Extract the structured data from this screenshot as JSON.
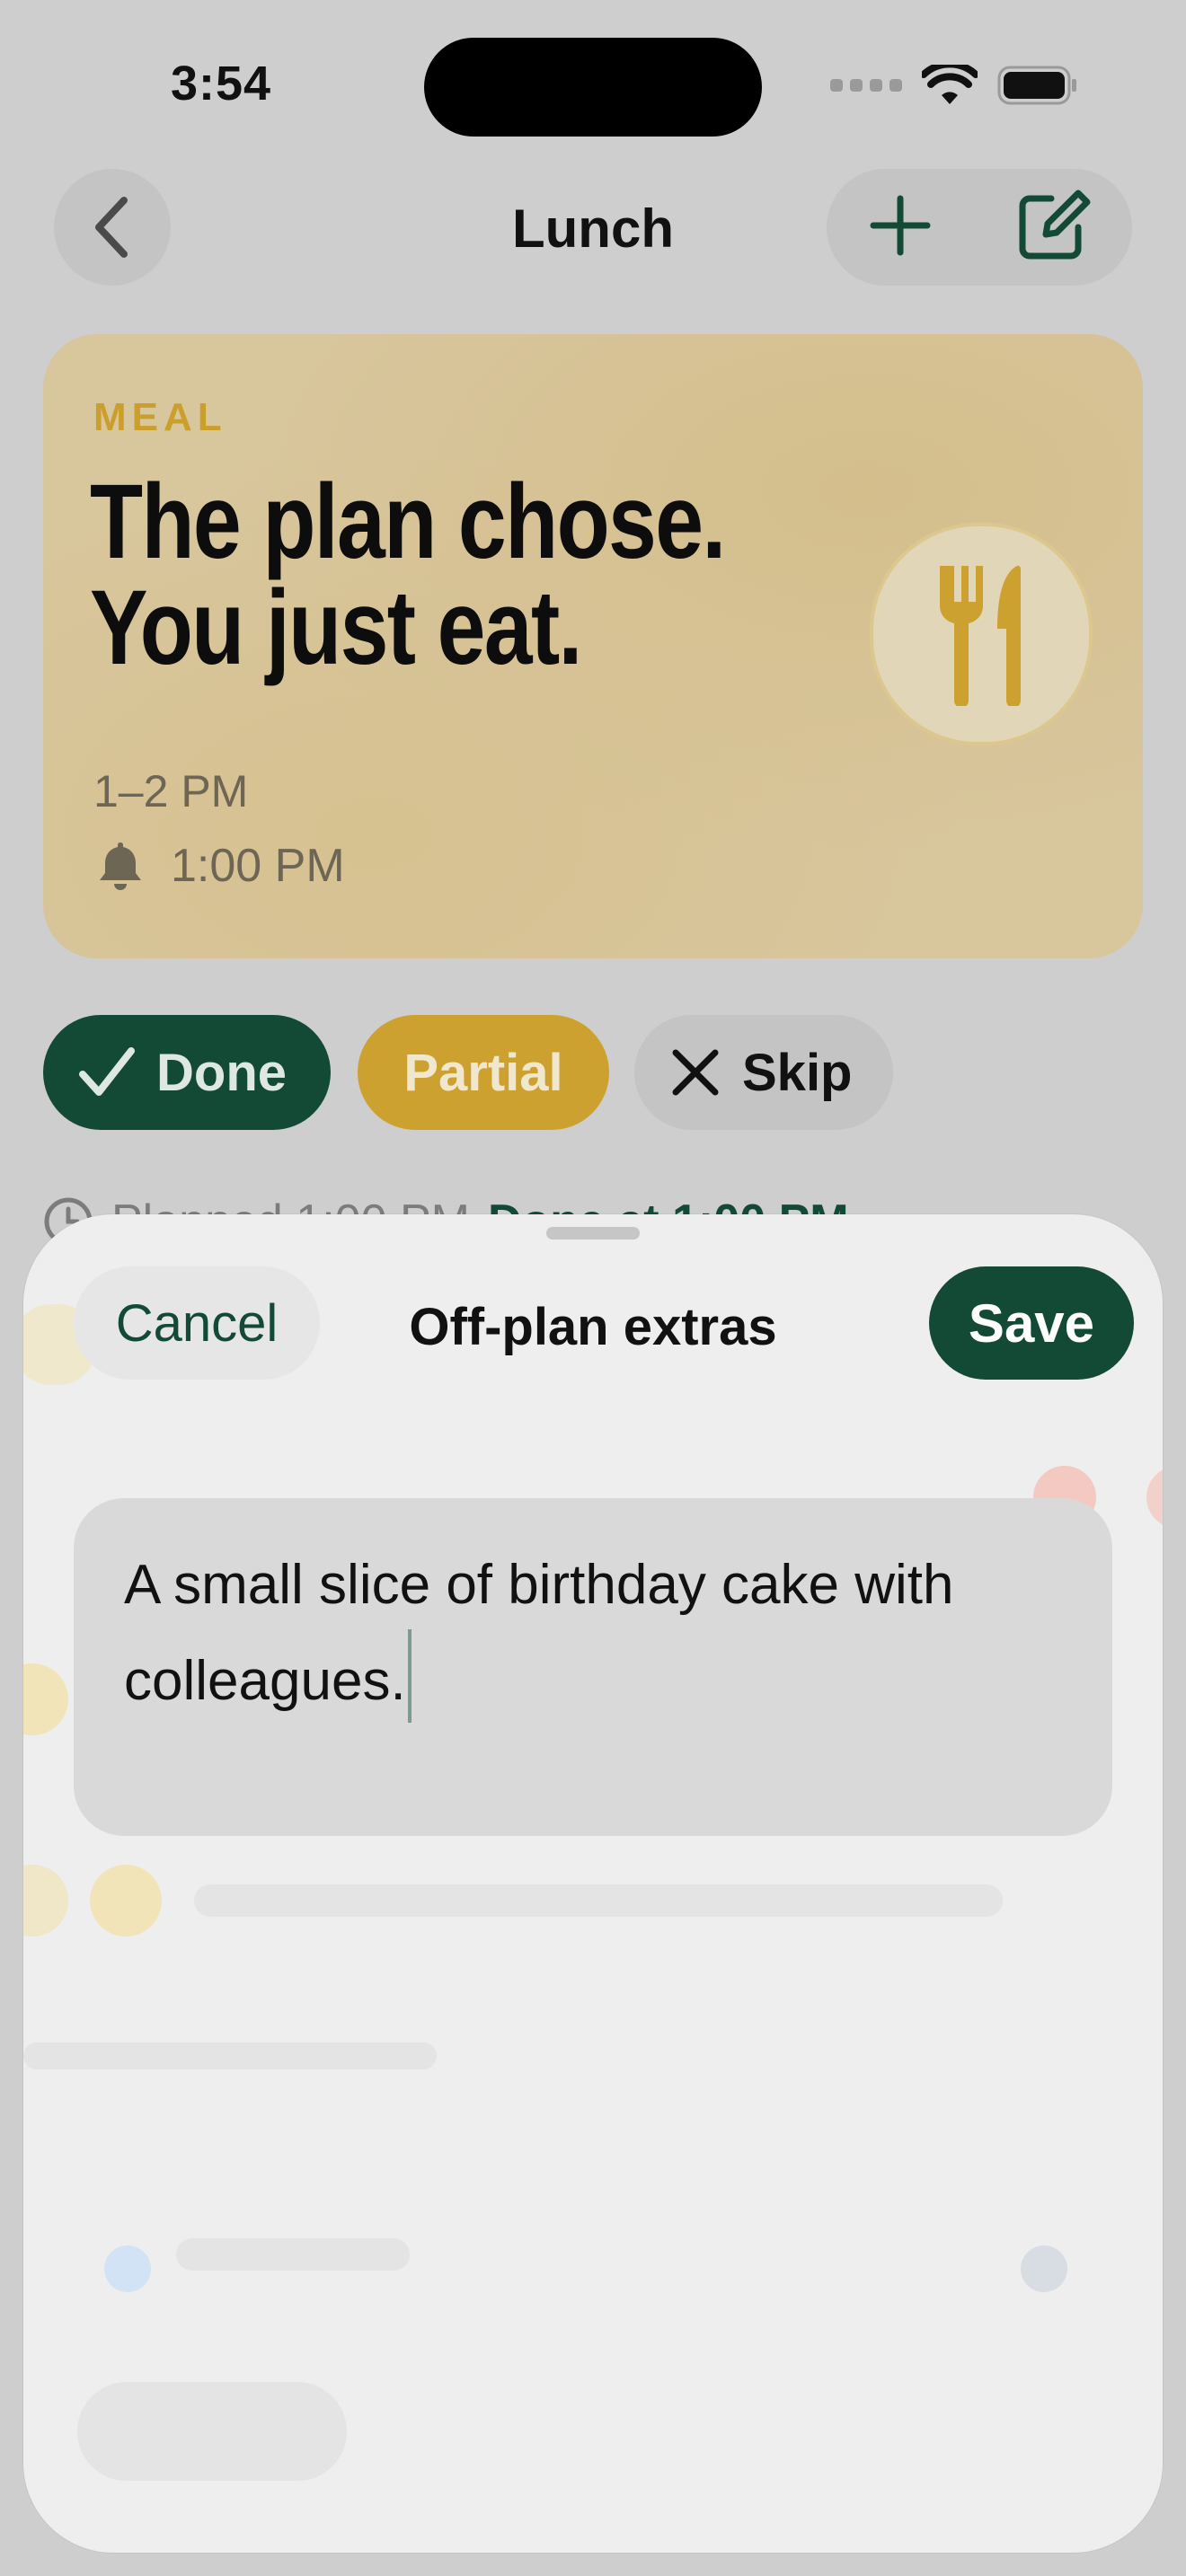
{
  "status_bar": {
    "time": "3:54"
  },
  "nav": {
    "title": "Lunch"
  },
  "meal_card": {
    "kicker": "MEAL",
    "headline_line1": "The plan chose.",
    "headline_line2": "You just eat.",
    "time_window": "1–2 PM",
    "reminder_time": "1:00 PM"
  },
  "actions": {
    "done_label": "Done",
    "partial_label": "Partial",
    "skip_label": "Skip"
  },
  "peek": {
    "planned_text": "Planned 1:00 PM",
    "done_text": "Done at 1:00 PM"
  },
  "sheet": {
    "cancel_label": "Cancel",
    "title": "Off-plan extras",
    "save_label": "Save",
    "field_value": "A small slice of birthday cake with colleagues."
  },
  "colors": {
    "brand_green": "#134a35",
    "accent_gold": "#cda130"
  }
}
